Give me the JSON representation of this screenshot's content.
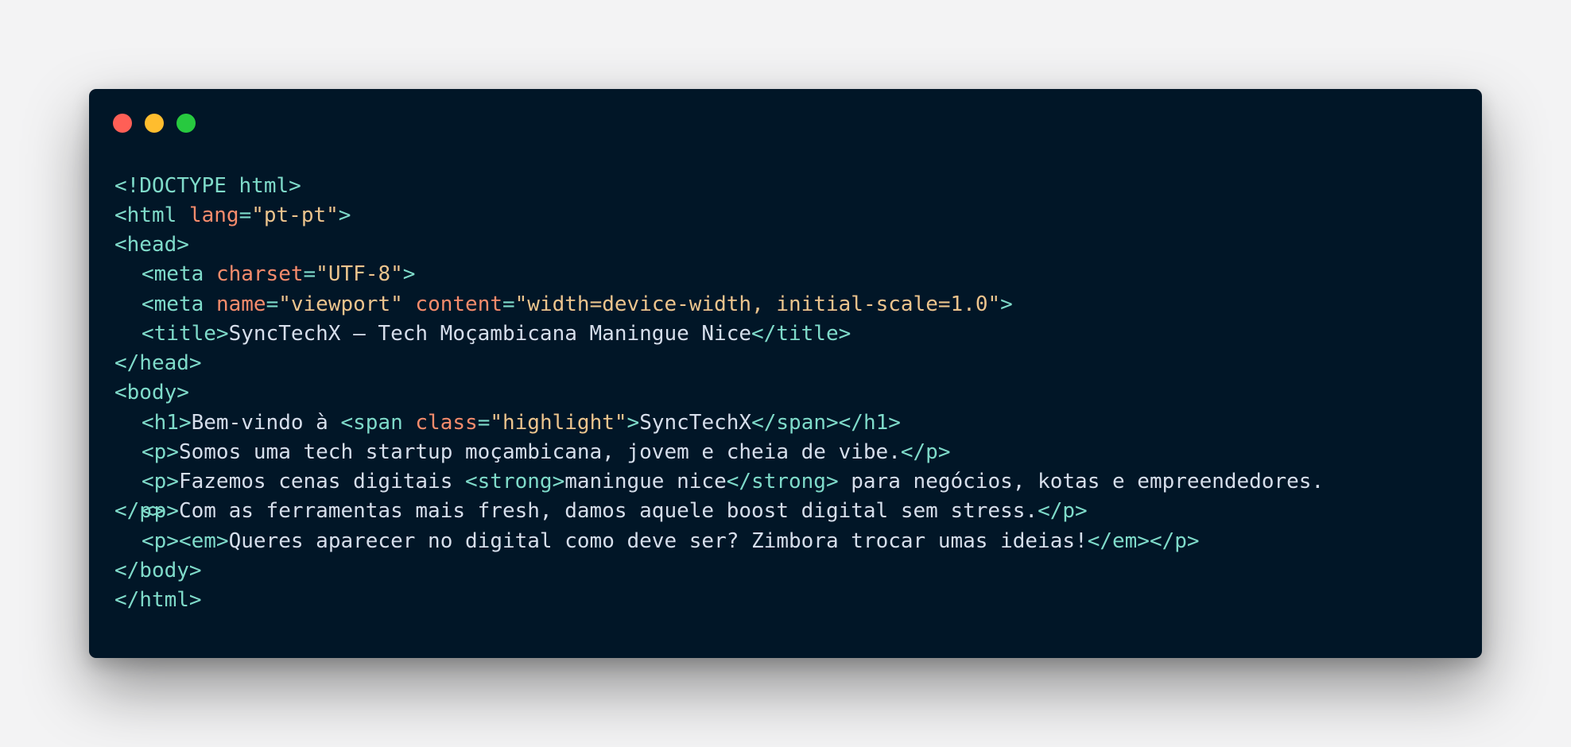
{
  "window": {
    "controls": [
      "close",
      "minimize",
      "maximize"
    ]
  },
  "code": {
    "doctype": "<!DOCTYPE html>",
    "html_open_tag": "<html",
    "html_lang_attr": "lang",
    "html_lang_eq": "=",
    "html_lang_value": "\"pt-pt\"",
    "html_open_end": ">",
    "head_open": "<head>",
    "meta1_open": "<meta",
    "meta1_attr": "charset",
    "meta1_eq": "=",
    "meta1_value": "\"UTF-8\"",
    "meta1_end": ">",
    "meta2_open": "<meta",
    "meta2_attr1": "name",
    "meta2_eq1": "=",
    "meta2_value1": "\"viewport\"",
    "meta2_attr2": "content",
    "meta2_eq2": "=",
    "meta2_value2": "\"width=device-width, initial-scale=1.0\"",
    "meta2_end": ">",
    "title_open": "<title>",
    "title_text": "SyncTechX — Tech Moçambicana Maningue Nice",
    "title_close": "</title>",
    "head_close": "</head>",
    "body_open": "<body>",
    "h1_open": "<h1>",
    "h1_text": "Bem-vindo à ",
    "span_open": "<span",
    "span_attr": "class",
    "span_eq": "=",
    "span_value": "\"highlight\"",
    "span_open_end": ">",
    "span_text": "SyncTechX",
    "span_close": "</span>",
    "h1_close": "</h1>",
    "p1_open": "<p>",
    "p1_text": "Somos uma tech startup moçambicana, jovem e cheia de vibe.",
    "p1_close": "</p>",
    "p2_open": "<p>",
    "p2_text_a": "Fazemos cenas digitais ",
    "strong_open": "<strong>",
    "strong_text": "maningue nice",
    "strong_close": "</strong>",
    "p2_text_b": " para negócios, kotas e empreendedores.",
    "p2_close": "</p>",
    "p3_open": "<p>",
    "p3_text": "Com as ferramentas mais fresh, damos aquele boost digital sem stress.",
    "p3_close": "</p>",
    "p4_open": "<p>",
    "em_open": "<em>",
    "em_text": "Queres aparecer no digital como deve ser? Zimbora trocar umas ideias!",
    "em_close": "</em>",
    "p4_close": "</p>",
    "body_close": "</body>",
    "html_close": "</html>"
  },
  "colors": {
    "background": "#011627",
    "tag": "#7fdbca",
    "attribute": "#f78c6c",
    "string": "#ecc48d",
    "text": "#d6deeb",
    "close": "#ff5f56",
    "minimize": "#ffbd2e",
    "maximize": "#27c93f"
  }
}
